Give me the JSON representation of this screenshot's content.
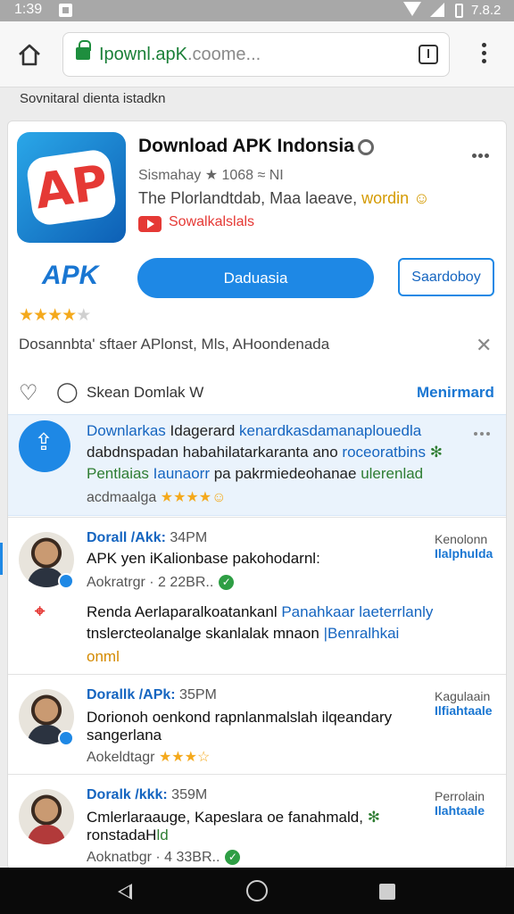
{
  "status_bar": {
    "time": "1:39",
    "battery": "7.8.2"
  },
  "browser": {
    "url_main": "Ipownl.apK",
    "url_domain": ".coome..."
  },
  "breadcrumb": "Sovnitaral dienta istadkn",
  "app": {
    "title": "Download APK Indonsia",
    "meta": "Sismahay ★ 1068 ≈ NI",
    "desc_text": "The Plorlandtdab, Maa laeave, ",
    "desc_accent": "wordin",
    "channel": "Sowalkalslals",
    "logo_letters": "AP",
    "apk_logo": "APK",
    "primary_button": "Daduasia",
    "secondary_button": "Saardoboy",
    "rating_stars": 3.5
  },
  "info_line": "Dosannbta' sftaer APlonst, Mls, AHoondenada",
  "actions": {
    "label": "Skean Domlak W",
    "link": "Menirmard"
  },
  "highlight": {
    "line1_a": "Downlarkas ",
    "line1_b": "Idagerard ",
    "line1_c": "kenardkasdamanaplouedla",
    "line2_a": "dabdnspadan habahilatarkaranta ano ",
    "line2_b": "roceoratbins",
    "line3_a": "Pentlaias ",
    "line3_b": "Iaunaorr",
    "line3_c": " pa pakrmiedeohanae ",
    "line3_d": "ulerenlad",
    "tags": "acdmaalga"
  },
  "comments": [
    {
      "author": "Dorall /Akk:",
      "time": "34PM",
      "text": "APK yen iKalionbase pakohodarnl:",
      "meta_label": "Aokratrgr",
      "meta_value": "· 2 22BR..",
      "right_top": "Kenolonn",
      "right_link": "Ilalphulda"
    },
    {
      "author": "Dorallk /APk:",
      "time": "35PM",
      "text_line1": "Dorionoh oenkond rapnlanmalslah ilqeandary",
      "text_line2": "sangerlana",
      "meta_label": "Aokeldtagr",
      "right_top": "Kagulaain",
      "right_link": "Ilfiahtaale"
    },
    {
      "author": "Doralk /kkk:",
      "time": "359M",
      "text_line1": "Cmlerlaraauge, Kapeslara oe fanahmald,",
      "text_line2": "ronstadaH",
      "text_line2_accent": "ld",
      "meta_label": "Aoknatbgr",
      "meta_value": "· 4 33BR..",
      "right_top": "Perrolain",
      "right_link": "Ilahtaale"
    }
  ],
  "reply": {
    "line1_a": "Renda Aerlaparalkoatankanl ",
    "line1_b": "Panahkaar laeterrlanly",
    "line2_a": "tnslercteolanalge skanlalak mnaon ",
    "line2_b": "|Benralhkai",
    "line3": "onml"
  },
  "colors": {
    "accent": "#1e88e5",
    "link": "#1976d2",
    "star": "#f4a91c",
    "danger": "#e53935",
    "success": "#2e9e44"
  }
}
